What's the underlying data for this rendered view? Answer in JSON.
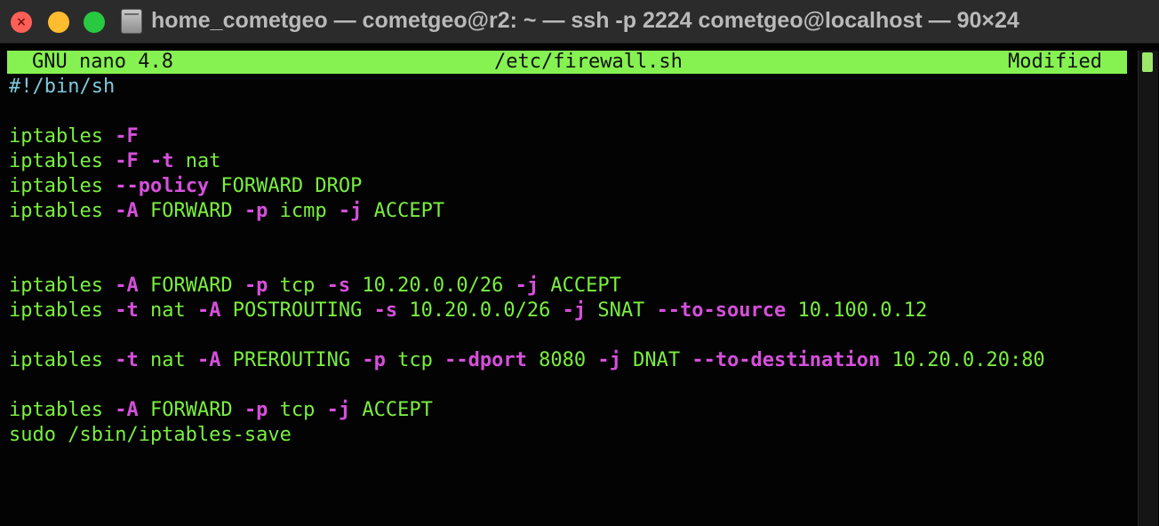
{
  "window": {
    "title": "home_cometgeo — cometgeo@r2: ~ — ssh -p 2224 cometgeo@localhost — 90×24",
    "close_glyph": "×"
  },
  "nano": {
    "version": "GNU nano 4.8",
    "filename": "/etc/firewall.sh",
    "status": "Modified"
  },
  "colors": {
    "header_bg": "#86f252",
    "command": "#79ef3f",
    "flag": "#d64fdc",
    "shebang": "#7fc9dc"
  },
  "editor": {
    "lines": [
      [
        {
          "t": "#!/bin/sh",
          "c": "comment"
        }
      ],
      [],
      [
        {
          "t": "iptables ",
          "c": "cmd"
        },
        {
          "t": "-F",
          "c": "flag"
        }
      ],
      [
        {
          "t": "iptables ",
          "c": "cmd"
        },
        {
          "t": "-F",
          "c": "flag"
        },
        {
          "t": " ",
          "c": "text"
        },
        {
          "t": "-t",
          "c": "flag"
        },
        {
          "t": " nat",
          "c": "text"
        }
      ],
      [
        {
          "t": "iptables ",
          "c": "cmd"
        },
        {
          "t": "--policy",
          "c": "flag"
        },
        {
          "t": " FORWARD DROP",
          "c": "text"
        }
      ],
      [
        {
          "t": "iptables ",
          "c": "cmd"
        },
        {
          "t": "-A",
          "c": "flag"
        },
        {
          "t": " FORWARD ",
          "c": "text"
        },
        {
          "t": "-p",
          "c": "flag"
        },
        {
          "t": " icmp ",
          "c": "text"
        },
        {
          "t": "-j",
          "c": "flag"
        },
        {
          "t": " ACCEPT",
          "c": "text"
        }
      ],
      [],
      [],
      [
        {
          "t": "iptables ",
          "c": "cmd"
        },
        {
          "t": "-A",
          "c": "flag"
        },
        {
          "t": " FORWARD ",
          "c": "text"
        },
        {
          "t": "-p",
          "c": "flag"
        },
        {
          "t": " tcp ",
          "c": "text"
        },
        {
          "t": "-s",
          "c": "flag"
        },
        {
          "t": " 10.20.0.0/26 ",
          "c": "text"
        },
        {
          "t": "-j",
          "c": "flag"
        },
        {
          "t": " ACCEPT",
          "c": "text"
        }
      ],
      [
        {
          "t": "iptables ",
          "c": "cmd"
        },
        {
          "t": "-t",
          "c": "flag"
        },
        {
          "t": " nat ",
          "c": "text"
        },
        {
          "t": "-A",
          "c": "flag"
        },
        {
          "t": " POSTROUTING ",
          "c": "text"
        },
        {
          "t": "-s",
          "c": "flag"
        },
        {
          "t": " 10.20.0.0/26 ",
          "c": "text"
        },
        {
          "t": "-j",
          "c": "flag"
        },
        {
          "t": " SNAT ",
          "c": "text"
        },
        {
          "t": "--to-source",
          "c": "flag"
        },
        {
          "t": " 10.100.0.12",
          "c": "text"
        }
      ],
      [],
      [
        {
          "t": "iptables ",
          "c": "cmd"
        },
        {
          "t": "-t",
          "c": "flag"
        },
        {
          "t": " nat ",
          "c": "text"
        },
        {
          "t": "-A",
          "c": "flag"
        },
        {
          "t": " PREROUTING ",
          "c": "text"
        },
        {
          "t": "-p",
          "c": "flag"
        },
        {
          "t": " tcp ",
          "c": "text"
        },
        {
          "t": "--dport",
          "c": "flag"
        },
        {
          "t": " 8080 ",
          "c": "text"
        },
        {
          "t": "-j",
          "c": "flag"
        },
        {
          "t": " DNAT ",
          "c": "text"
        },
        {
          "t": "--to-destination",
          "c": "flag"
        },
        {
          "t": " 10.20.0.20:80",
          "c": "text"
        }
      ],
      [],
      [
        {
          "t": "iptables ",
          "c": "cmd"
        },
        {
          "t": "-A",
          "c": "flag"
        },
        {
          "t": " FORWARD ",
          "c": "text"
        },
        {
          "t": "-p",
          "c": "flag"
        },
        {
          "t": " tcp ",
          "c": "text"
        },
        {
          "t": "-j",
          "c": "flag"
        },
        {
          "t": " ACCEPT",
          "c": "text"
        }
      ],
      [
        {
          "t": "sudo /sbin/iptables-save",
          "c": "cmd"
        }
      ]
    ]
  }
}
